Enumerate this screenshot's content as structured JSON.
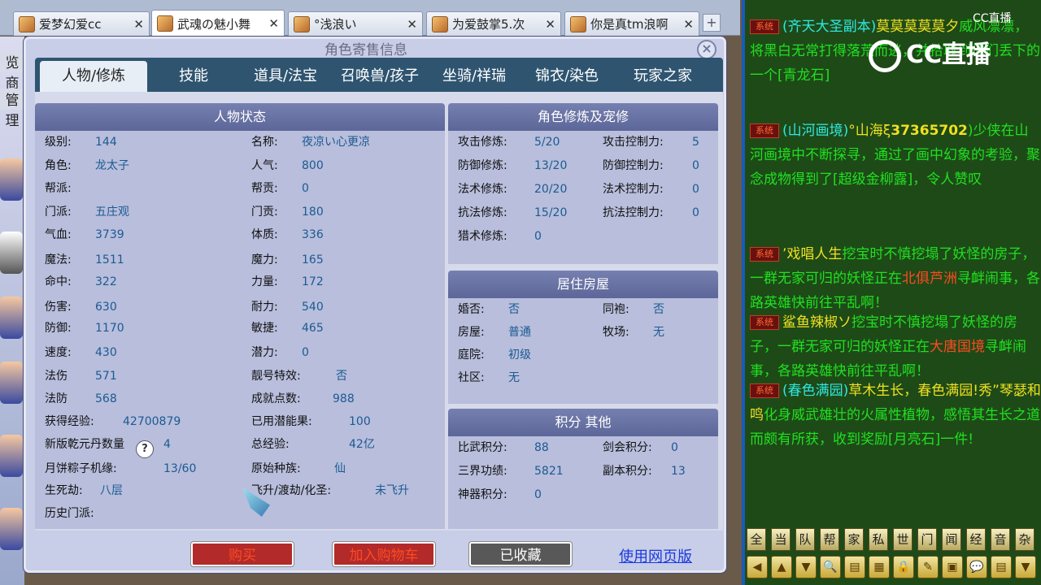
{
  "tabs": [
    {
      "label": "爱梦幻爱cc"
    },
    {
      "label": "武魂の魅小舞"
    },
    {
      "label": "°浅浪い"
    },
    {
      "label": "为爱鼓掌5.次"
    },
    {
      "label": "你是真tm浪啊"
    }
  ],
  "left": {
    "menu1": "览商",
    "menu2": "管理"
  },
  "dialog": {
    "title": "角色寄售信息",
    "close": "×",
    "tabs": [
      "人物/修炼",
      "技能",
      "道具/法宝",
      "召唤兽/孩子",
      "坐骑/祥瑞",
      "锦衣/染色",
      "玩家之家"
    ]
  },
  "status": {
    "header": "人物状态",
    "left": [
      {
        "k": "级别:",
        "v": "144"
      },
      {
        "k": "角色:",
        "v": "龙太子"
      },
      {
        "k": "帮派:",
        "v": ""
      },
      {
        "k": "门派:",
        "v": "五庄观"
      },
      {
        "k": "气血:",
        "v": "3739"
      },
      {
        "k": "魔法:",
        "v": "1511"
      },
      {
        "k": "命中:",
        "v": "322"
      },
      {
        "k": "伤害:",
        "v": "630"
      },
      {
        "k": "防御:",
        "v": "1170"
      },
      {
        "k": "速度:",
        "v": "430"
      },
      {
        "k": "法伤",
        "v": "571"
      },
      {
        "k": "法防",
        "v": "568"
      },
      {
        "k": "获得经验:",
        "v": "42700879"
      },
      {
        "k": "新版乾元丹数量",
        "v": "4"
      },
      {
        "k": "月饼粽子机缘:",
        "v": "13/60"
      },
      {
        "k": "生死劫:",
        "v": "八层"
      },
      {
        "k": "历史门派:",
        "v": ""
      }
    ],
    "right": [
      {
        "k": "名称:",
        "v": "夜凉い心更凉"
      },
      {
        "k": "人气:",
        "v": "800"
      },
      {
        "k": "帮贡:",
        "v": "0"
      },
      {
        "k": "门贡:",
        "v": "180"
      },
      {
        "k": "体质:",
        "v": "336"
      },
      {
        "k": "魔力:",
        "v": "165"
      },
      {
        "k": "力量:",
        "v": "172"
      },
      {
        "k": "耐力:",
        "v": "540"
      },
      {
        "k": "敏捷:",
        "v": "465"
      },
      {
        "k": "潜力:",
        "v": "0"
      },
      {
        "k": "靓号特效:",
        "v": "否"
      },
      {
        "k": "成就点数:",
        "v": "988"
      },
      {
        "k": "已用潜能果:",
        "v": "100"
      },
      {
        "k": "总经验:",
        "v": "42亿"
      },
      {
        "k": "原始种族:",
        "v": "仙"
      },
      {
        "k": "飞升/渡劫/化圣:",
        "v": "未飞升"
      }
    ],
    "help": "?"
  },
  "cultivation": {
    "header": "角色修炼及宠修",
    "left": [
      {
        "k": "攻击修炼:",
        "v": "5/20"
      },
      {
        "k": "防御修炼:",
        "v": "13/20"
      },
      {
        "k": "法术修炼:",
        "v": "20/20"
      },
      {
        "k": "抗法修炼:",
        "v": "15/20"
      },
      {
        "k": "猎术修炼:",
        "v": "0"
      }
    ],
    "right": [
      {
        "k": "攻击控制力:",
        "v": "5"
      },
      {
        "k": "防御控制力:",
        "v": "0"
      },
      {
        "k": "法术控制力:",
        "v": "0"
      },
      {
        "k": "抗法控制力:",
        "v": "0"
      }
    ]
  },
  "house": {
    "header": "居住房屋",
    "left": [
      {
        "k": "婚否:",
        "v": "否"
      },
      {
        "k": "房屋:",
        "v": "普通"
      },
      {
        "k": "庭院:",
        "v": "初级"
      },
      {
        "k": "社区:",
        "v": "无"
      }
    ],
    "right": [
      {
        "k": "同袍:",
        "v": "否"
      },
      {
        "k": "牧场:",
        "v": "无"
      }
    ]
  },
  "points": {
    "header": "积分 其他",
    "left": [
      {
        "k": "比武积分:",
        "v": "88"
      },
      {
        "k": "三界功绩:",
        "v": "5821"
      },
      {
        "k": "神器积分:",
        "v": "0"
      }
    ],
    "right": [
      {
        "k": "剑会积分:",
        "v": "0"
      },
      {
        "k": "副本积分:",
        "v": "13"
      }
    ]
  },
  "footer": {
    "buy": "购买",
    "cart": "加入购物车",
    "fav": "已收藏",
    "web": "使用网页版"
  },
  "chat": {
    "sys": "系统",
    "m1a": "(齐天大圣副本)",
    "m1b": "莫莫莫莫莫夕",
    "m1c": "威风凛凛，将黑白无常打得落荒而逃，并拾取到他们丢下的一个[青龙石]",
    "m2a": "(山河画境)",
    "m2b": "°山海ξ",
    "m2c": "37365702",
    "m2d": ")少侠在山河画境中不断探寻，通过了画中幻象的考验，聚念成物得到了[超级金柳露]，令人赞叹",
    "m3a": "’戏唱人生",
    "m3b": "挖宝时不慎挖塌了妖怪的房子，一群无家可归的妖怪正在",
    "m3c": "北俱芦洲",
    "m3d": "寻衅闹事，各路英雄快前往平乱啊！",
    "m4a": "鲨鱼辣椒ソ",
    "m4b": "挖宝时不慎挖塌了妖怪的房子，一群无家可归的妖怪正在",
    "m4c": "大唐国境",
    "m4d": "寻衅闹事，各路英雄快前往平乱啊！",
    "m5a": "(春色满园)",
    "m5b": "草木生长，春色满园!",
    "m5c": "秀”琴瑟和鸣",
    "m5d": "化身威武雄壮的火属性植物，感悟其生长之道而颇有所获，收到奖励[月亮石]一件!"
  },
  "cc": {
    "logo": "CC直播",
    "top": "CC直播"
  },
  "channels": [
    "全",
    "当",
    "队",
    "帮",
    "家",
    "私",
    "世",
    "门",
    "闻",
    "经",
    "音",
    "杂"
  ],
  "tools": [
    "◀",
    "▲",
    "▼",
    "🔍",
    "▤",
    "▦",
    "🔒",
    "✎",
    "▣",
    "💬",
    "▤",
    "▼"
  ]
}
